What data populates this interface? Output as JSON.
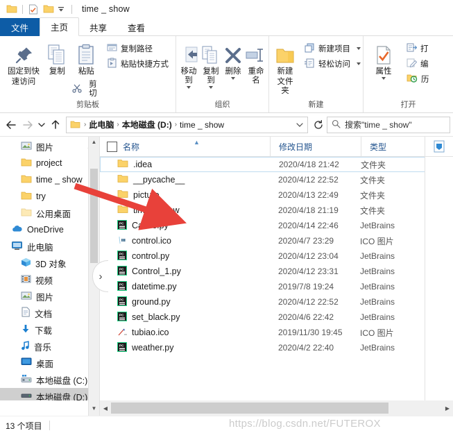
{
  "window": {
    "title": "time _ show",
    "quick_access_icons": [
      "folder-icon",
      "properties-checkmark-icon",
      "folder-new-icon",
      "customize-caret-icon"
    ]
  },
  "tabs": [
    {
      "label": "文件",
      "key": "file",
      "state": "file"
    },
    {
      "label": "主页",
      "key": "home",
      "state": "active"
    },
    {
      "label": "共享",
      "key": "share",
      "state": "normal"
    },
    {
      "label": "查看",
      "key": "view",
      "state": "normal"
    }
  ],
  "ribbon": {
    "groups": [
      {
        "label": "剪贴板",
        "big": [
          {
            "label": "固定到快\n速访问",
            "label_line1": "固定到快",
            "label_line2": "速访问",
            "icon": "pin-icon"
          },
          {
            "label": "复制",
            "icon": "copy-icon"
          },
          {
            "label": "粘贴",
            "icon": "paste-icon",
            "extra": "剪切",
            "extra_icon": "scissors-icon"
          }
        ],
        "small": [
          {
            "label": "复制路径",
            "icon": "copy-path-icon"
          },
          {
            "label": "粘贴快捷方式",
            "icon": "paste-shortcut-icon"
          }
        ]
      },
      {
        "label": "组织",
        "big": [
          {
            "label": "移动到",
            "icon": "move-to-icon",
            "has_dropdown": true
          },
          {
            "label": "复制到",
            "icon": "copy-to-icon",
            "has_dropdown": true
          },
          {
            "label": "删除",
            "icon": "delete-x-icon",
            "has_dropdown": true
          },
          {
            "label": "重命名",
            "icon": "rename-icon"
          }
        ],
        "small": []
      },
      {
        "label": "新建",
        "big": [
          {
            "label_line1": "新建",
            "label_line2": "文件夹",
            "icon": "new-folder-icon"
          }
        ],
        "small": [
          {
            "label": "新建项目",
            "icon": "new-item-icon",
            "has_dropdown": true
          },
          {
            "label": "轻松访问",
            "icon": "easy-access-icon",
            "has_dropdown": true
          }
        ]
      },
      {
        "label": "打开",
        "big": [
          {
            "label": "属性",
            "icon": "properties-icon",
            "has_dropdown": true
          }
        ],
        "small": [
          {
            "label": "打",
            "icon": "open-icon"
          },
          {
            "label": "编",
            "icon": "edit-icon"
          },
          {
            "label": "历",
            "icon": "history-icon"
          }
        ]
      }
    ]
  },
  "navbar": {
    "back_icon": "arrow-left-icon",
    "forward_icon": "arrow-right-icon",
    "recent_icon": "chevron-down-icon",
    "up_icon": "arrow-up-icon",
    "breadcrumbs": [
      "此电脑",
      "本地磁盘 (D:)",
      "time _ show"
    ],
    "breadcrumb_separator": "›",
    "dropdown_icon": "chevron-down-icon",
    "refresh_icon": "refresh-icon",
    "search_icon": "search-icon",
    "search_placeholder": "搜索\"time _ show\"",
    "search_value": "搜索\"time _ show\""
  },
  "navpane": {
    "items": [
      {
        "label": "图片",
        "icon": "pictures-icon",
        "indent": 1,
        "pinned": true,
        "selected": false
      },
      {
        "label": "project",
        "icon": "folder-icon",
        "indent": 2,
        "selected": false
      },
      {
        "label": "time _ show",
        "icon": "folder-icon",
        "indent": 2,
        "selected": false
      },
      {
        "label": "try",
        "icon": "folder-icon",
        "indent": 2,
        "selected": false
      },
      {
        "label": "公用桌面",
        "icon": "folder-pale-icon",
        "indent": 2,
        "selected": false
      },
      {
        "label": "OneDrive",
        "icon": "onedrive-cloud-icon",
        "indent": 0,
        "selected": false
      },
      {
        "label": "此电脑",
        "icon": "this-pc-icon",
        "indent": 0,
        "selected": false
      },
      {
        "label": "3D 对象",
        "icon": "3d-objects-icon",
        "indent": 1,
        "selected": false
      },
      {
        "label": "视频",
        "icon": "videos-icon",
        "indent": 1,
        "selected": false
      },
      {
        "label": "图片",
        "icon": "pictures-icon",
        "indent": 1,
        "selected": false
      },
      {
        "label": "文档",
        "icon": "documents-icon",
        "indent": 1,
        "selected": false
      },
      {
        "label": "下载",
        "icon": "downloads-icon",
        "indent": 1,
        "selected": false
      },
      {
        "label": "音乐",
        "icon": "music-icon",
        "indent": 1,
        "selected": false
      },
      {
        "label": "桌面",
        "icon": "desktop-icon",
        "indent": 1,
        "selected": false
      },
      {
        "label": "本地磁盘 (C:)",
        "icon": "drive-system-icon",
        "indent": 1,
        "selected": false
      },
      {
        "label": "本地磁盘 (D:)",
        "icon": "drive-icon",
        "indent": 1,
        "selected": true
      }
    ]
  },
  "filelist": {
    "columns": [
      {
        "label": "名称",
        "key": "name",
        "sorted": "asc"
      },
      {
        "label": "修改日期",
        "key": "date"
      },
      {
        "label": "类型",
        "key": "type"
      }
    ],
    "select_all_checkbox": false,
    "rows": [
      {
        "name": ".idea",
        "date": "2020/4/18 21:42",
        "type": "文件夹",
        "icon": "folder-icon",
        "focused": true
      },
      {
        "name": "__pycache__",
        "date": "2020/4/12 22:52",
        "type": "文件夹",
        "icon": "folder-icon",
        "focused": false
      },
      {
        "name": "picture",
        "date": "2020/4/13 22:49",
        "type": "文件夹",
        "icon": "folder-icon",
        "focused": false
      },
      {
        "name": "time _ show",
        "date": "2020/4/18 21:19",
        "type": "文件夹",
        "icon": "folder-icon",
        "focused": false
      },
      {
        "name": "Canve.py",
        "date": "2020/4/14 22:46",
        "type": "JetBrains",
        "icon": "pycharm-icon",
        "focused": false
      },
      {
        "name": "control.ico",
        "date": "2020/4/7 23:29",
        "type": "ICO 图片",
        "icon": "ico-file-icon",
        "focused": false
      },
      {
        "name": "control.py",
        "date": "2020/4/12 23:04",
        "type": "JetBrains",
        "icon": "pycharm-icon",
        "focused": false
      },
      {
        "name": "Control_1.py",
        "date": "2020/4/12 23:31",
        "type": "JetBrains",
        "icon": "pycharm-icon",
        "focused": false
      },
      {
        "name": "datetime.py",
        "date": "2019/7/8 19:24",
        "type": "JetBrains",
        "icon": "pycharm-icon",
        "focused": false
      },
      {
        "name": "ground.py",
        "date": "2020/4/12 22:52",
        "type": "JetBrains",
        "icon": "pycharm-icon",
        "focused": false
      },
      {
        "name": "set_black.py",
        "date": "2020/4/6 22:42",
        "type": "JetBrains",
        "icon": "pycharm-icon",
        "focused": false
      },
      {
        "name": "tubiao.ico",
        "date": "2019/11/30 19:45",
        "type": "ICO 图片",
        "icon": "ico-chart-icon",
        "focused": false
      },
      {
        "name": "weather.py",
        "date": "2020/4/2 22:40",
        "type": "JetBrains",
        "icon": "pycharm-icon",
        "focused": false
      }
    ]
  },
  "statusbar": {
    "item_count": "13 个项目"
  },
  "annotation": {
    "arrow_color": "#e8413a",
    "arrow_from": "nav-time-show",
    "arrow_to": "row-time-show"
  },
  "watermark": {
    "text": "https://blog.csdn.net/FUTEROX"
  },
  "colors": {
    "file_tab_blue": "#0d5ca6",
    "column_header_text": "#24558f",
    "selection_gray": "#cfcfcf",
    "focus_border": "#bfdcf0",
    "folder_yellow": "#fbd269"
  }
}
